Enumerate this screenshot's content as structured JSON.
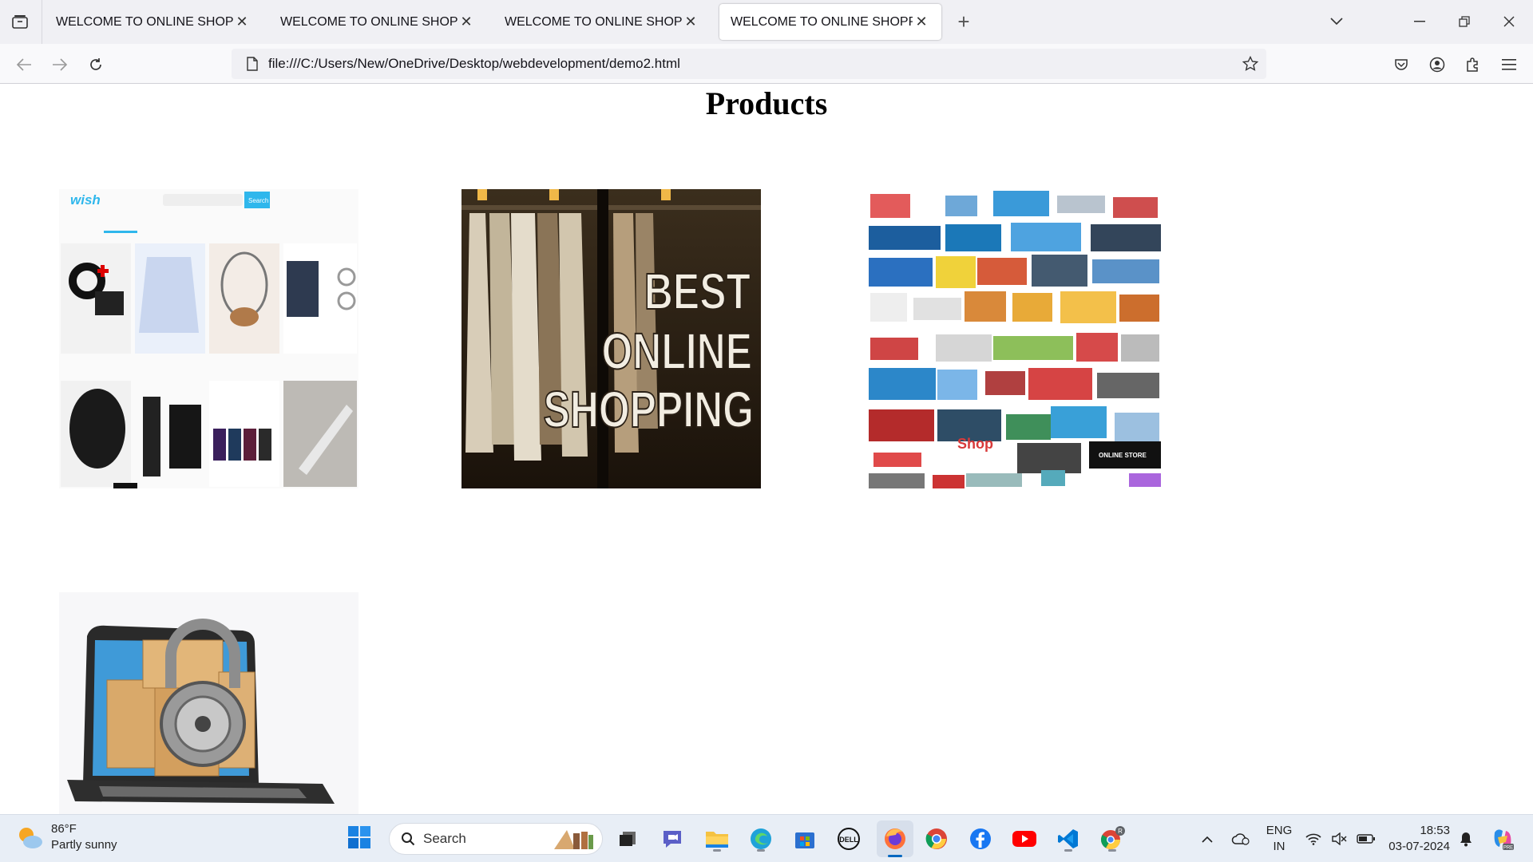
{
  "browser": {
    "tabs": [
      {
        "title": "WELCOME TO ONLINE SHOPPING",
        "active": false
      },
      {
        "title": "WELCOME TO ONLINE SHOPPING",
        "active": false
      },
      {
        "title": "WELCOME TO ONLINE SHOPPING",
        "active": false
      },
      {
        "title": "WELCOME TO ONLINE SHOPPING",
        "active": true
      }
    ],
    "tab_close_glyph": "✕",
    "new_tab_glyph": "+",
    "url": "file:///C:/Users/New/OneDrive/Desktop/webdevelopment/demo2.html"
  },
  "page": {
    "heading": "Products",
    "products": [
      {
        "image": "wish-app-product-grid",
        "text_lines": [
          "BEST",
          "ONLINE",
          "SHOPPING"
        ]
      },
      {
        "image": "clothing-rack-best-online-shopping"
      },
      {
        "image": "online-store-icon-collage",
        "badges": [
          "Shop",
          "ONLINE STORE"
        ]
      },
      {
        "image": "laptop-boxes-padlock"
      }
    ],
    "wish_logo": "wish",
    "wish_search_btn": "Search"
  },
  "taskbar": {
    "weather_temp": "86°F",
    "weather_desc": "Partly sunny",
    "search_label": "Search",
    "lang_line1": "ENG",
    "lang_line2": "IN",
    "time": "18:53",
    "date": "03-07-2024"
  },
  "colors": {
    "tabbar_bg": "#f0f0f4",
    "taskbar_bg": "#e8eef6",
    "win_blue": "#0078d4"
  }
}
